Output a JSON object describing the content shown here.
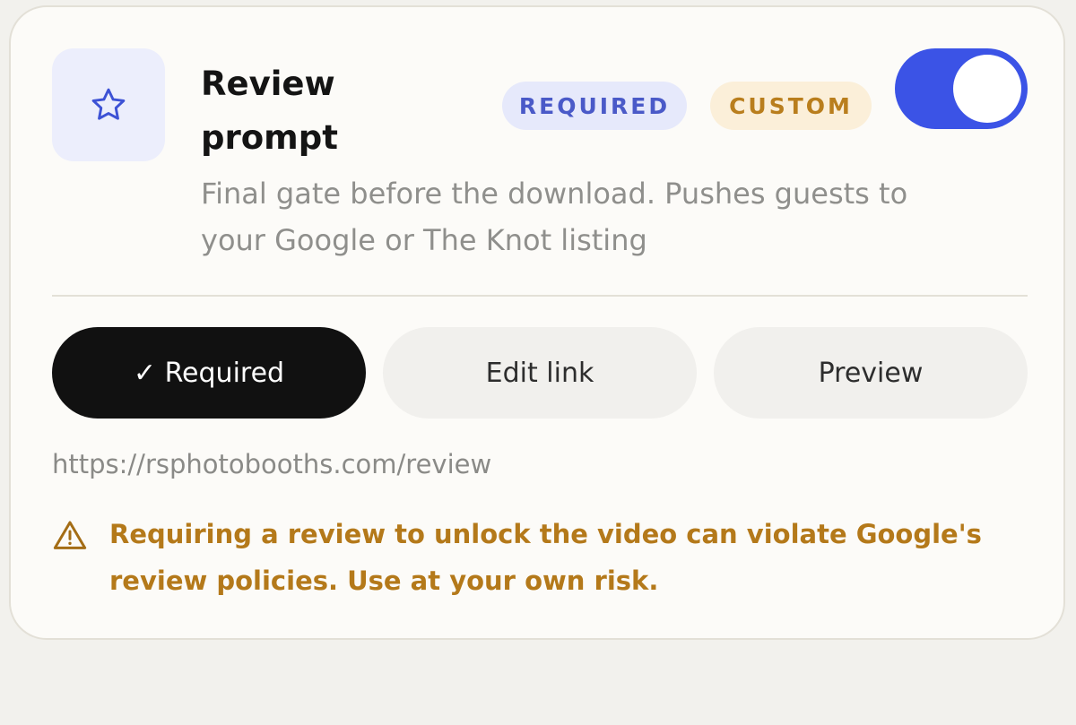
{
  "card": {
    "icon": "star-icon",
    "title": "Review prompt",
    "badges": {
      "required": "REQUIRED",
      "custom": "CUSTOM"
    },
    "toggle": {
      "enabled": true
    },
    "description": "Final gate before the download. Pushes guests to your Google or The Knot listing",
    "actions": {
      "required_label": "✓ Required",
      "edit_label": "Edit link",
      "preview_label": "Preview"
    },
    "url": "https://rsphotobooths.com/review",
    "warning": {
      "icon": "warning-triangle-icon",
      "text": "Requiring a review to unlock the video can violate Google's review policies. Use at your own risk."
    }
  },
  "colors": {
    "accent": "#3b53e6",
    "warning": "#b4791a",
    "badge_required_bg": "#e6e9fb",
    "badge_custom_bg": "#fbefd9"
  }
}
